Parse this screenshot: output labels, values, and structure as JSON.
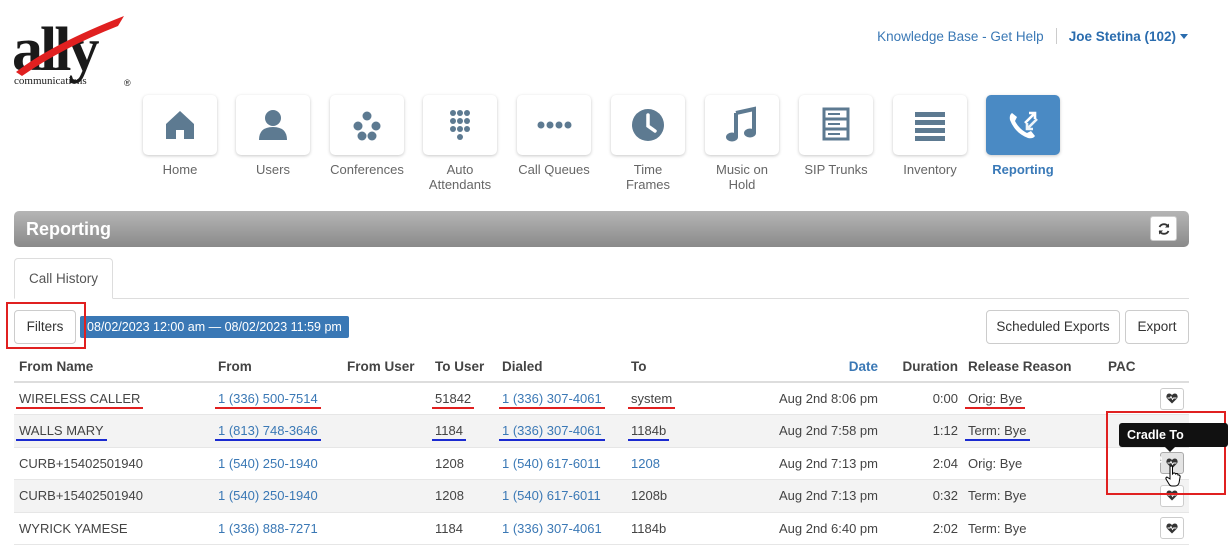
{
  "brand": {
    "logo_text": "ally",
    "logo_sub": "communications",
    "accent": "#3a78b5"
  },
  "topnav": {
    "help_link": "Knowledge Base - Get Help",
    "user": "Joe Stetina (102)"
  },
  "nav": [
    {
      "label": "Home",
      "icon": "home-icon"
    },
    {
      "label": "Users",
      "icon": "user-icon"
    },
    {
      "label": "Conferences",
      "icon": "conference-icon"
    },
    {
      "label": "Auto Attendants",
      "icon": "keypad-icon"
    },
    {
      "label": "Call Queues",
      "icon": "queue-dots-icon"
    },
    {
      "label": "Time Frames",
      "icon": "clock-icon"
    },
    {
      "label": "Music on Hold",
      "icon": "music-icon"
    },
    {
      "label": "SIP Trunks",
      "icon": "server-icon"
    },
    {
      "label": "Inventory",
      "icon": "list-icon"
    },
    {
      "label": "Reporting",
      "icon": "phone-arrows-icon",
      "active": true
    }
  ],
  "panel": {
    "title": "Reporting"
  },
  "tabs": {
    "call_history": "Call History"
  },
  "filters": {
    "filters_label": "Filters",
    "date_range": "08/02/2023 12:00 am — 08/02/2023 11:59 pm",
    "scheduled_exports": "Scheduled Exports",
    "export": "Export"
  },
  "table": {
    "headers": [
      "From Name",
      "From",
      "From User",
      "To User",
      "Dialed",
      "To",
      "Date",
      "Duration",
      "Release Reason",
      "PAC"
    ],
    "rows": [
      {
        "from_name": "WIRELESS CALLER",
        "from": "1 (336) 500-7514",
        "from_user": "",
        "to_user": "51842",
        "dialed": "1 (336) 307-4061",
        "to": "system",
        "date": "Aug 2nd 8:06 pm",
        "duration": "0:00",
        "release": "Orig: Bye"
      },
      {
        "from_name": "WALLS MARY",
        "from": "1 (813) 748-3646",
        "from_user": "",
        "to_user": "1184",
        "dialed": "1 (336) 307-4061",
        "to": "1184b",
        "date": "Aug 2nd 7:58 pm",
        "duration": "1:12",
        "release": "Term: Bye"
      },
      {
        "from_name": "CURB+15402501940",
        "from": "1 (540) 250-1940",
        "from_user": "",
        "to_user": "1208",
        "dialed": "1 (540) 617-6011",
        "to": "1208",
        "date": "Aug 2nd 7:13 pm",
        "duration": "2:04",
        "release": "Orig: Bye"
      },
      {
        "from_name": "CURB+15402501940",
        "from": "1 (540) 250-1940",
        "from_user": "",
        "to_user": "1208",
        "dialed": "1 (540) 617-6011",
        "to": "1208b",
        "date": "Aug 2nd 7:13 pm",
        "duration": "0:32",
        "release": "Term: Bye"
      },
      {
        "from_name": "WYRICK YAMESE",
        "from": "1 (336) 888-7271",
        "from_user": "",
        "to_user": "1184",
        "dialed": "1 (336) 307-4061",
        "to": "1184b",
        "date": "Aug 2nd 6:40 pm",
        "duration": "2:02",
        "release": "Term: Bye"
      }
    ]
  },
  "tooltip": "Cradle To Grave",
  "annotation_colors": {
    "red": "#e02020",
    "blue": "#1a2ad0"
  }
}
